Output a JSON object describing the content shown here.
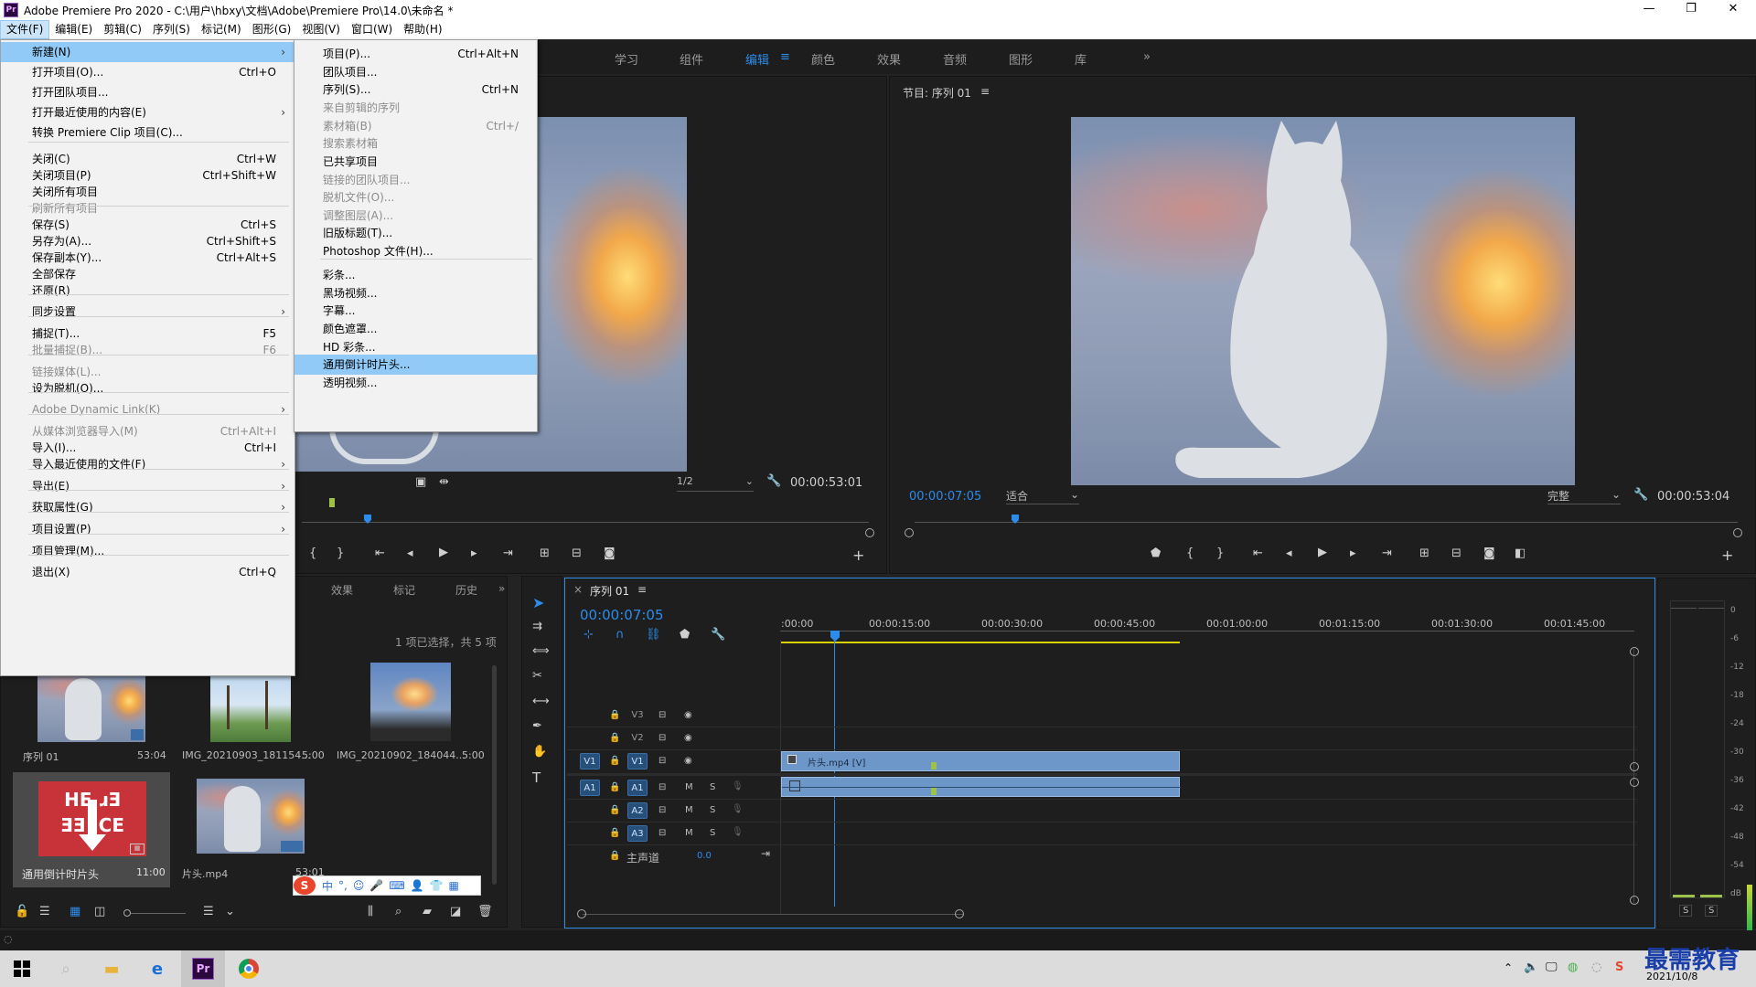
{
  "window": {
    "title": "Adobe Premiere Pro 2020 - C:\\用户\\hbxy\\文档\\Adobe\\Premiere Pro\\14.0\\未命名 *",
    "logo": "Pr",
    "minimize": "—",
    "restore": "❐",
    "close": "✕"
  },
  "menubar": [
    "文件(F)",
    "编辑(E)",
    "剪辑(C)",
    "序列(S)",
    "标记(M)",
    "图形(G)",
    "视图(V)",
    "窗口(W)",
    "帮助(H)"
  ],
  "workspaces": [
    "学习",
    "组件",
    "编辑",
    "颜色",
    "效果",
    "音频",
    "图形",
    "库",
    "»"
  ],
  "workspace_active": "编辑",
  "workspace_menu_icon": "≡",
  "file_menu": [
    {
      "label": "新建(N)",
      "shortcut": "",
      "arrow": true,
      "disabled": false,
      "highlight": true
    },
    {
      "label": "打开项目(O)...",
      "shortcut": "Ctrl+O",
      "arrow": false,
      "disabled": false
    },
    {
      "label": "打开团队项目...",
      "shortcut": "",
      "arrow": false,
      "disabled": false
    },
    {
      "label": "打开最近使用的内容(E)",
      "shortcut": "",
      "arrow": true,
      "disabled": false
    },
    {
      "label": "转换 Premiere Clip 项目(C)...",
      "shortcut": "",
      "arrow": false,
      "disabled": false
    },
    {
      "label": "关闭(C)",
      "shortcut": "Ctrl+W",
      "arrow": false,
      "disabled": false
    },
    {
      "label": "关闭项目(P)",
      "shortcut": "Ctrl+Shift+W",
      "arrow": false,
      "disabled": false
    },
    {
      "label": "关闭所有项目",
      "shortcut": "",
      "arrow": false,
      "disabled": false
    },
    {
      "label": "刷新所有项目",
      "shortcut": "",
      "arrow": false,
      "disabled": true
    },
    {
      "label": "保存(S)",
      "shortcut": "Ctrl+S",
      "arrow": false,
      "disabled": false
    },
    {
      "label": "另存为(A)...",
      "shortcut": "Ctrl+Shift+S",
      "arrow": false,
      "disabled": false
    },
    {
      "label": "保存副本(Y)...",
      "shortcut": "Ctrl+Alt+S",
      "arrow": false,
      "disabled": false
    },
    {
      "label": "全部保存",
      "shortcut": "",
      "arrow": false,
      "disabled": false
    },
    {
      "label": "还原(R)",
      "shortcut": "",
      "arrow": false,
      "disabled": false
    },
    {
      "label": "同步设置",
      "shortcut": "",
      "arrow": true,
      "disabled": false
    },
    {
      "label": "捕捉(T)...",
      "shortcut": "F5",
      "arrow": false,
      "disabled": false
    },
    {
      "label": "批量捕捉(B)...",
      "shortcut": "F6",
      "arrow": false,
      "disabled": true
    },
    {
      "label": "链接媒体(L)...",
      "shortcut": "",
      "arrow": false,
      "disabled": true
    },
    {
      "label": "设为脱机(O)...",
      "shortcut": "",
      "arrow": false,
      "disabled": false
    },
    {
      "label": "Adobe Dynamic Link(K)",
      "shortcut": "",
      "arrow": true,
      "disabled": true
    },
    {
      "label": "从媒体浏览器导入(M)",
      "shortcut": "Ctrl+Alt+I",
      "arrow": false,
      "disabled": true
    },
    {
      "label": "导入(I)...",
      "shortcut": "Ctrl+I",
      "arrow": false,
      "disabled": false
    },
    {
      "label": "导入最近使用的文件(F)",
      "shortcut": "",
      "arrow": true,
      "disabled": false
    },
    {
      "label": "导出(E)",
      "shortcut": "",
      "arrow": true,
      "disabled": false
    },
    {
      "label": "获取属性(G)",
      "shortcut": "",
      "arrow": true,
      "disabled": false
    },
    {
      "label": "项目设置(P)",
      "shortcut": "",
      "arrow": true,
      "disabled": false
    },
    {
      "label": "项目管理(M)...",
      "shortcut": "",
      "arrow": false,
      "disabled": false
    },
    {
      "label": "退出(X)",
      "shortcut": "Ctrl+Q",
      "arrow": false,
      "disabled": false
    }
  ],
  "new_submenu": [
    {
      "label": "项目(P)...",
      "shortcut": "Ctrl+Alt+N",
      "disabled": false
    },
    {
      "label": "团队项目...",
      "shortcut": "",
      "disabled": false
    },
    {
      "label": "序列(S)...",
      "shortcut": "Ctrl+N",
      "disabled": false
    },
    {
      "label": "来自剪辑的序列",
      "shortcut": "",
      "disabled": true
    },
    {
      "label": "素材箱(B)",
      "shortcut": "Ctrl+/",
      "disabled": true
    },
    {
      "label": "搜索素材箱",
      "shortcut": "",
      "disabled": true
    },
    {
      "label": "已共享项目",
      "shortcut": "",
      "disabled": false
    },
    {
      "label": "链接的团队项目...",
      "shortcut": "",
      "disabled": true
    },
    {
      "label": "脱机文件(O)...",
      "shortcut": "",
      "disabled": true
    },
    {
      "label": "调整图层(A)...",
      "shortcut": "",
      "disabled": true
    },
    {
      "label": "旧版标题(T)...",
      "shortcut": "",
      "disabled": false
    },
    {
      "label": "Photoshop 文件(H)...",
      "shortcut": "",
      "disabled": false
    },
    {
      "label": "彩条...",
      "shortcut": "",
      "disabled": false
    },
    {
      "label": "黑场视频...",
      "shortcut": "",
      "disabled": false
    },
    {
      "label": "字幕...",
      "shortcut": "",
      "disabled": false
    },
    {
      "label": "颜色遮罩...",
      "shortcut": "",
      "disabled": false
    },
    {
      "label": "HD 彩条...",
      "shortcut": "",
      "disabled": false
    },
    {
      "label": "通用倒计时片头...",
      "shortcut": "",
      "disabled": false,
      "highlight": true
    },
    {
      "label": "透明视频...",
      "shortcut": "",
      "disabled": false
    }
  ],
  "source_monitor": {
    "resolution": "1/2",
    "duration": "00:00:53:01"
  },
  "program_monitor": {
    "title": "节目: 序列 01",
    "menu_icon": "≡",
    "timecode": "00:00:07:05",
    "zoom": "适合",
    "quality": "完整",
    "duration": "00:00:53:04"
  },
  "project_panel": {
    "tabs": [
      "效果",
      "标记",
      "历史",
      "»"
    ],
    "selection_info": "1 项已选择，共 5 项",
    "items": [
      {
        "name": "序列 01",
        "duration": "53:04"
      },
      {
        "name": "IMG_20210903_181154...",
        "duration": "5:00"
      },
      {
        "name": "IMG_20210902_184044...",
        "duration": "5:00"
      },
      {
        "name": "通用倒计时片头",
        "duration": "11:00"
      },
      {
        "name": "片头.mp4",
        "duration": "53:01"
      }
    ],
    "countdown_thumb_text_top": "HE ɹƎ",
    "countdown_thumb_text_bottom": "ƎƎ ICE"
  },
  "timeline": {
    "tab": "序列 01",
    "close": "×",
    "menu_icon": "≡",
    "timecode": "00:00:07:05",
    "ruler": [
      ":00:00",
      "00:00:15:00",
      "00:00:30:00",
      "00:00:45:00",
      "00:01:00:00",
      "00:01:15:00",
      "00:01:30:00",
      "00:01:45:00"
    ],
    "tracks_video": [
      "V3",
      "V2",
      "V1"
    ],
    "tracks_audio": [
      "A1",
      "A2",
      "A3"
    ],
    "src_video": "V1",
    "src_audio": "A1",
    "mute": "M",
    "solo": "S",
    "master_label": "主声道",
    "master_value": "0.0",
    "clip_label": "片头.mp4 [V]"
  },
  "audio_meter": {
    "scale": [
      "0",
      "-6",
      "-12",
      "-18",
      "-24",
      "-30",
      "-36",
      "-42",
      "-48",
      "-54",
      "dB"
    ],
    "solo_buttons": [
      "S",
      "S"
    ]
  },
  "ime_bar": [
    "中",
    "°,",
    "☺",
    "🎤",
    "⌨",
    "👤",
    "👕",
    "▦"
  ],
  "taskbar": {
    "date": "2021/10/8",
    "watermark": "最需教育"
  },
  "colors": {
    "accent": "#2d8ceb",
    "highlight": "#91c9f7",
    "clip_video": "#6d97c8",
    "timeline_border": "#2d8ceb"
  }
}
